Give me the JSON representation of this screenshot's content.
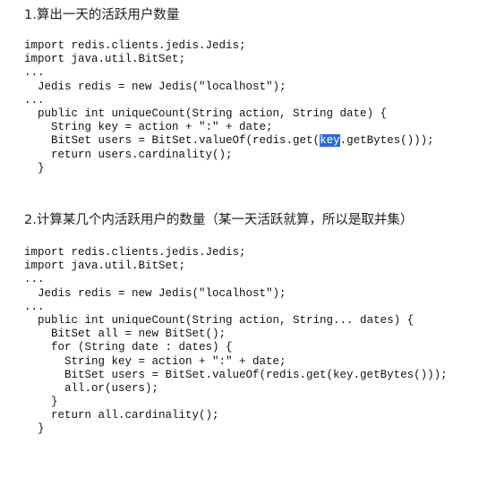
{
  "section1": {
    "title": "1.算出一天的活跃用户数量",
    "lines": [
      "import redis.clients.jedis.Jedis;",
      "import java.util.BitSet;",
      "...",
      "  Jedis redis = new Jedis(\"localhost\");",
      "...",
      "  public int uniqueCount(String action, String date) {",
      "    String key = action + \":\" + date;",
      "    BitSet users = BitSet.valueOf(redis.get(",
      "    return users.cardinality();",
      "  }"
    ],
    "highlighted_token": "key",
    "line8_suffix": ".getBytes()));"
  },
  "section2": {
    "title": "2.计算某几个内活跃用户的数量（某一天活跃就算，所以是取并集）",
    "lines": [
      "import redis.clients.jedis.Jedis;",
      "import java.util.BitSet;",
      "...",
      "  Jedis redis = new Jedis(\"localhost\");",
      "...",
      "  public int uniqueCount(String action, String... dates) {",
      "    BitSet all = new BitSet();",
      "    for (String date : dates) {",
      "      String key = action + \":\" + date;",
      "      BitSet users = BitSet.valueOf(redis.get(key.getBytes()));",
      "      all.or(users);",
      "    }",
      "    return all.cardinality();",
      "  }"
    ]
  }
}
